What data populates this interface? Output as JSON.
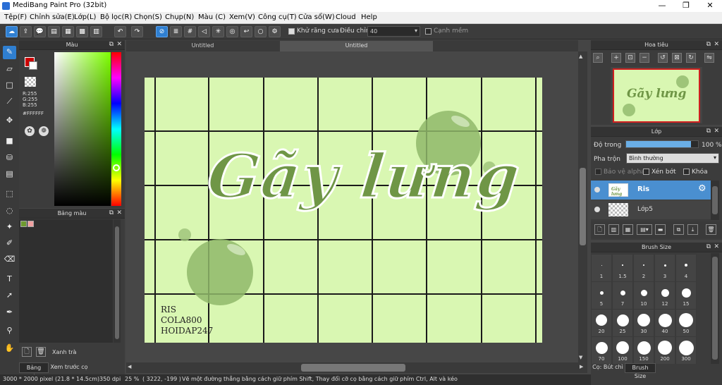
{
  "title": "MediBang Paint Pro (32bit)",
  "window_controls": [
    "—",
    "❐",
    "✕"
  ],
  "menu": [
    "Tệp(F)",
    "Chỉnh sửa(E)",
    "Lớp(L)",
    "Bộ lọc(R)",
    "Chọn(S)",
    "Chụp(N)",
    "Màu (C)",
    "Xem(V)",
    "Công cụ(T)",
    "Cửa sổ(W)",
    "Cloud",
    "Help"
  ],
  "toolbar": {
    "antialias_label": "Khử răng cưa",
    "correction_label": "Điều chỉnh",
    "correction_value": "40",
    "edge_label": "Cạnh mềm"
  },
  "color_panel": {
    "title": "Màu",
    "r": "R:255",
    "g": "G:255",
    "b": "B:255",
    "hex": "#FFFFFF",
    "fg_color": "#ffffff",
    "bg_color": "#cc0000"
  },
  "palette_panel": {
    "title": "Bảng màu",
    "palette_name": "Xanh trà",
    "tabs": [
      "Bảng màu",
      "Xem trước cọ"
    ]
  },
  "tabs": [
    "Untitled",
    "Untitled"
  ],
  "canvas": {
    "artwork_title": "Gãy lưng",
    "credits": [
      "RIS",
      "COLA800",
      "HOIDAP247"
    ]
  },
  "navigator": {
    "title": "Hoa tiêu"
  },
  "layer_panel": {
    "title": "Lớp",
    "opacity_label": "Độ trong",
    "opacity_value": "100 %",
    "opacity_fraction": 0.9,
    "blend_label": "Pha trộn",
    "blend_value": "Bình thường",
    "protect_label": "Bảo vệ alpha",
    "clip_label": "Xén bớt",
    "lock_label": "Khóa",
    "layers": [
      {
        "name": "Ris",
        "selected": true
      },
      {
        "name": "Lớp5",
        "selected": false
      }
    ]
  },
  "brush_size_panel": {
    "title": "Brush Size",
    "sizes": [
      "1",
      "1.5",
      "2",
      "3",
      "4",
      "5",
      "7",
      "10",
      "12",
      "15",
      "20",
      "25",
      "30",
      "40",
      "50",
      "70",
      "100",
      "150",
      "200",
      "300"
    ],
    "tabs": [
      "Cọ: Bút chì",
      "Brush Size"
    ]
  },
  "status": {
    "size": "3000 * 2000 pixel",
    "physical": "(21.8 * 14.5cm)",
    "dpi": "350 dpi",
    "zoom": "25 %",
    "coords": "( 3222, -199 )",
    "hint": "Vẽ một đường thẳng bằng cách giữ phím Shift, Thay đổi cỡ cọ bằng cách giữ phím Ctrl, Alt và kéo"
  }
}
